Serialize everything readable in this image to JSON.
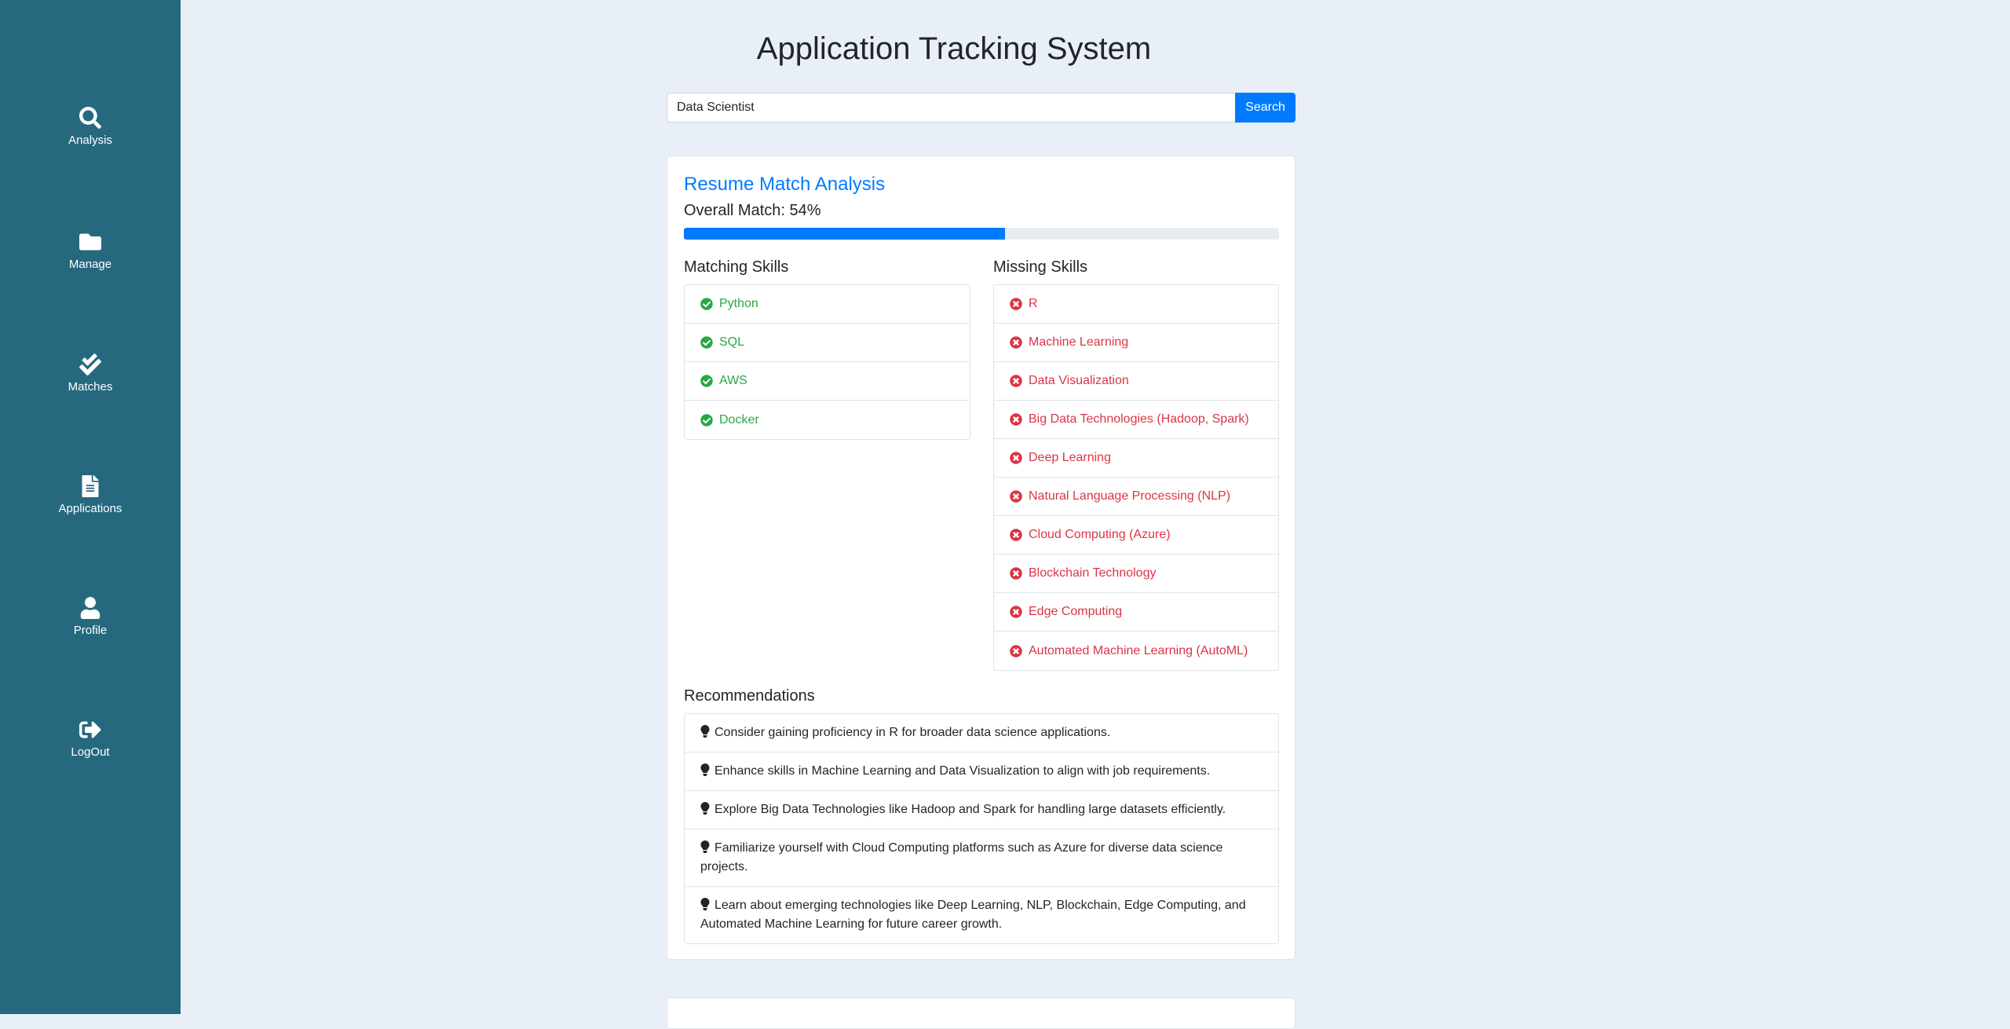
{
  "sidebar": {
    "items": [
      {
        "label": "Analysis",
        "icon": "search-icon"
      },
      {
        "label": "Manage",
        "icon": "folder-icon"
      },
      {
        "label": "Matches",
        "icon": "double-check-icon"
      },
      {
        "label": "Applications",
        "icon": "file-icon"
      },
      {
        "label": "Profile",
        "icon": "user-icon"
      },
      {
        "label": "LogOut",
        "icon": "sign-out-icon"
      }
    ]
  },
  "header": {
    "title": "Application Tracking System"
  },
  "search": {
    "value": "Data Scientist",
    "button_label": "Search"
  },
  "analysis": {
    "title": "Resume Match Analysis",
    "overall_label": "Overall Match: 54%",
    "match_percent": 54,
    "matching_heading": "Matching Skills",
    "missing_heading": "Missing Skills",
    "matching_skills": [
      "Python",
      "SQL",
      "AWS",
      "Docker"
    ],
    "missing_skills": [
      "R",
      "Machine Learning",
      "Data Visualization",
      "Big Data Technologies (Hadoop, Spark)",
      "Deep Learning",
      "Natural Language Processing (NLP)",
      "Cloud Computing (Azure)",
      "Blockchain Technology",
      "Edge Computing",
      "Automated Machine Learning (AutoML)"
    ],
    "recommendations_heading": "Recommendations",
    "recommendations": [
      "Consider gaining proficiency in R for broader data science applications.",
      "Enhance skills in Machine Learning and Data Visualization to align with job requirements.",
      "Explore Big Data Technologies like Hadoop and Spark for handling large datasets efficiently.",
      "Familiarize yourself with Cloud Computing platforms such as Azure for diverse data science projects.",
      "Learn about emerging technologies like Deep Learning, NLP, Blockchain, Edge Computing, and Automated Machine Learning for future career growth."
    ]
  },
  "colors": {
    "sidebar_bg": "#26697f",
    "accent": "#007bff",
    "match_green": "#28a745",
    "missing_red": "#dc3545",
    "page_bg": "#e9eff6"
  }
}
